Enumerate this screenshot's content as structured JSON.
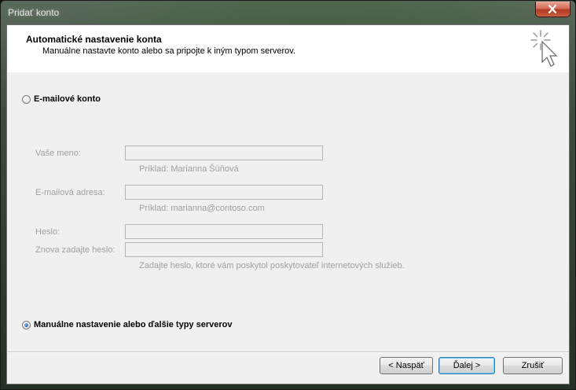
{
  "window": {
    "title": "Pridať konto"
  },
  "header": {
    "title": "Automatické nastavenie konta",
    "subtitle": "Manuálne nastavte konto alebo sa pripojte k iným typom serverov."
  },
  "options": {
    "email_account": {
      "label": "E-mailové konto",
      "checked": false
    },
    "manual_setup": {
      "label": "Manuálne nastavenie alebo ďalšie typy serverov",
      "checked": true
    }
  },
  "form": {
    "name_label": "Vaše meno:",
    "name_value": "",
    "name_hint": "Príklad: Marianna Šúňová",
    "email_label": "E-mailová adresa:",
    "email_value": "",
    "email_hint": "Príklad: marianna@contoso.com",
    "password_label": "Heslo:",
    "password_value": "",
    "retype_label": "Znova zadajte heslo:",
    "retype_value": "",
    "password_hint": "Zadajte heslo, ktoré vám poskytol poskytovateľ internetových služieb."
  },
  "buttons": {
    "back": "< Naspäť",
    "next": "Ďalej >",
    "cancel": "Zrušiť"
  },
  "icons": {
    "close": "close-icon",
    "wizard": "wizard-cursor-icon"
  }
}
